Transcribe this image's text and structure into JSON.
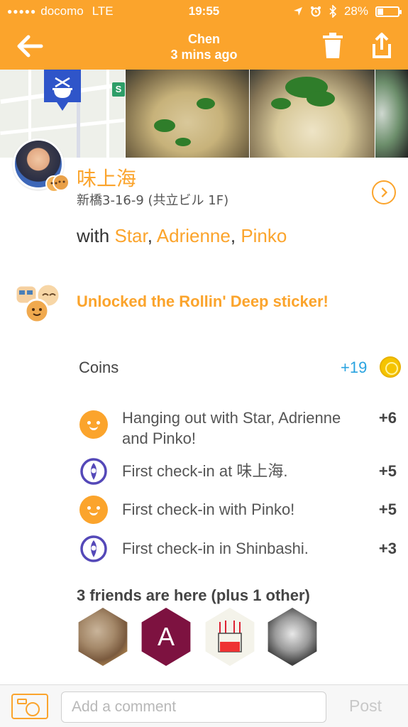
{
  "status_bar": {
    "carrier": "docomo",
    "network": "LTE",
    "time": "19:55",
    "battery": "28%"
  },
  "header": {
    "title": "Chen",
    "subtitle": "3 mins ago",
    "back_icon": "back-arrow-icon",
    "trash_icon": "trash-icon",
    "share_icon": "share-icon",
    "color": "#FBA42C"
  },
  "map": {
    "station_label": "S"
  },
  "venue": {
    "name": "味上海",
    "address": "新橋3-16-9 (共立ビル 1F)"
  },
  "with": {
    "prefix": "with",
    "friends": [
      "Star",
      "Adrienne",
      "Pinko"
    ],
    "sep1": ",",
    "sep2": ","
  },
  "sticker": {
    "text": "Unlocked the Rollin' Deep sticker!"
  },
  "coins": {
    "label": "Coins",
    "total": "+19",
    "rows": [
      {
        "icon": "smiley-icon",
        "text": "Hanging out with Star, Adrienne and Pinko!",
        "points": "+6"
      },
      {
        "icon": "checkin-pin-icon",
        "text": "First check-in at 味上海.",
        "points": "+5"
      },
      {
        "icon": "smiley-icon",
        "text": "First check-in with Pinko!",
        "points": "+5"
      },
      {
        "icon": "checkin-pin-icon",
        "text": "First check-in in Shinbashi.",
        "points": "+3"
      }
    ]
  },
  "friends": {
    "title": "3 friends are here (plus 1 other)",
    "avatars": [
      {
        "initial": ""
      },
      {
        "initial": "A"
      },
      {
        "initial": ""
      },
      {
        "initial": ""
      }
    ]
  },
  "comment_bar": {
    "placeholder": "Add a comment",
    "post_label": "Post"
  },
  "colors": {
    "accent": "#FBA42C",
    "coins_blue": "#29A3E0",
    "checkin_purple": "#5448B8"
  }
}
